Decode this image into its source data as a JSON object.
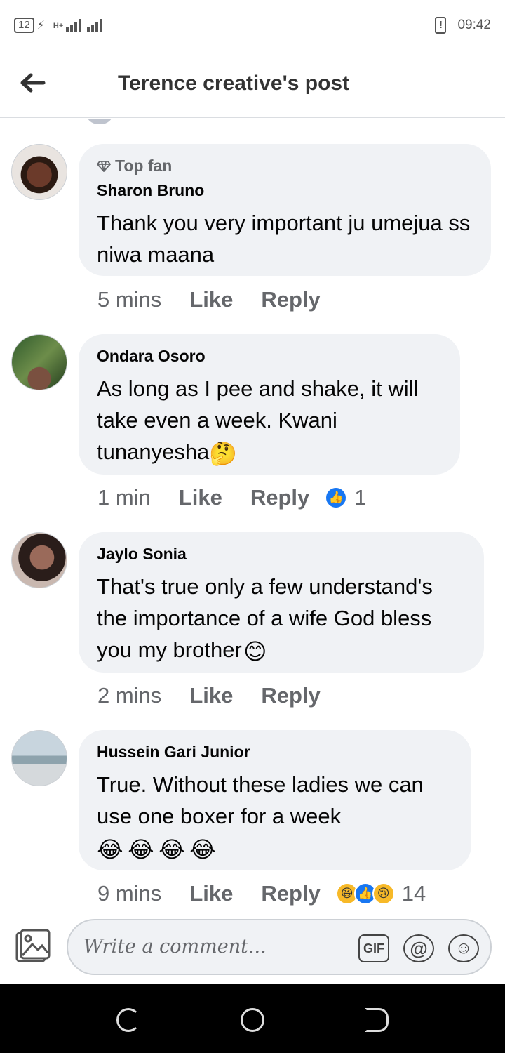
{
  "status_bar": {
    "battery": "12",
    "network": "H+",
    "time": "09:42"
  },
  "header": {
    "back_icon": "arrow-left-icon",
    "title": "Terence creative's post"
  },
  "comments": [
    {
      "author": "Sharon Bruno",
      "badge": "Top fan",
      "text": "Thank you very important ju umejua ss niwa maana",
      "time": "5 mins",
      "like": "Like",
      "reply": "Reply"
    },
    {
      "author": "Ondara Osoro",
      "text": "As long as I pee and shake, it will take even a week. Kwani tunanyesha",
      "emoji": "🤔",
      "time": "1 min",
      "like": "Like",
      "reply": "Reply",
      "reaction_count": "1"
    },
    {
      "author": "Jaylo Sonia",
      "text": "That's true only a few understand's the importance of a wife God bless you my brother",
      "emoji": "😊",
      "time": "2 mins",
      "like": "Like",
      "reply": "Reply"
    },
    {
      "author": "Hussein Gari Junior",
      "text": "True. Without these ladies we can use one boxer for a week",
      "emojis": [
        "😂",
        "😂",
        "😂",
        "😂"
      ],
      "time": "9 mins",
      "like": "Like",
      "reply": "Reply",
      "reaction_count": "14"
    }
  ],
  "composer": {
    "placeholder": "Write a comment...",
    "gif": "GIF",
    "at": "@",
    "smile": "☺"
  },
  "colors": {
    "bubble": "#f0f2f5",
    "meta": "#65676b",
    "like_blue": "#1877f2"
  }
}
